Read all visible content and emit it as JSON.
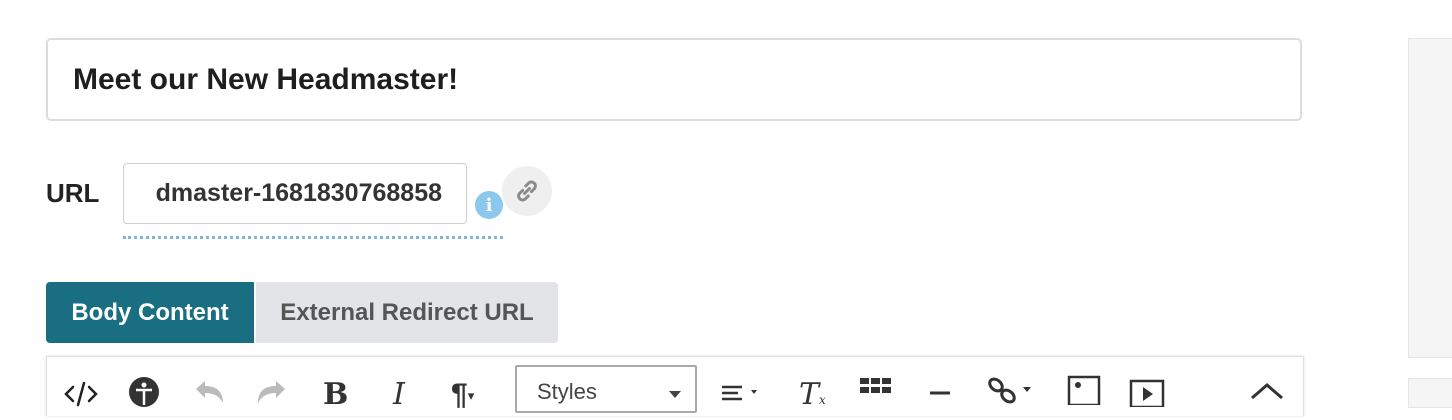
{
  "page_title_field": {
    "value": "Meet our New Headmaster!"
  },
  "url_field": {
    "label": "URL",
    "value": "dmaster-1681830768858",
    "info_icon": "info-icon",
    "link_icon": "link-icon"
  },
  "content_tabs": [
    {
      "label": "Body Content",
      "active": true
    },
    {
      "label": "External Redirect URL",
      "active": false
    }
  ],
  "editor_toolbar": {
    "styles_select": {
      "value": "Styles"
    },
    "icons": [
      "code-view-icon",
      "accessibility-icon",
      "undo-icon",
      "redo-icon",
      "bold-icon",
      "italic-icon",
      "paragraph-icon",
      "align-icon",
      "clear-format-icon",
      "table-icon",
      "horizontal-rule-icon",
      "link-icon",
      "image-icon",
      "video-icon",
      "collapse-toolbar-icon"
    ]
  },
  "colors": {
    "active_tab": "#1a6e82",
    "inactive_tab": "#e3e4e8",
    "info_icon": "#8cc8ec",
    "dotted_underline": "#7fb7d8"
  }
}
